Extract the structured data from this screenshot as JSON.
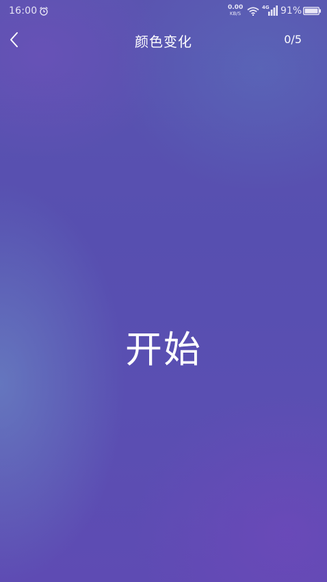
{
  "status_bar": {
    "time": "16:00",
    "net_speed_value": "0.00",
    "net_speed_unit": "KB/S",
    "network_type": "4G",
    "battery_percent": "91%",
    "icons": [
      "alarm-icon",
      "wifi-icon",
      "signal-icon",
      "battery-icon"
    ]
  },
  "header": {
    "back_icon": "chevron-left-icon",
    "title": "颜色变化",
    "progress": "0/5"
  },
  "main": {
    "start_label": "开始"
  },
  "colors": {
    "background_top": "#5a54b0",
    "background_bottom": "#5e4bb3",
    "text": "#ffffff"
  }
}
